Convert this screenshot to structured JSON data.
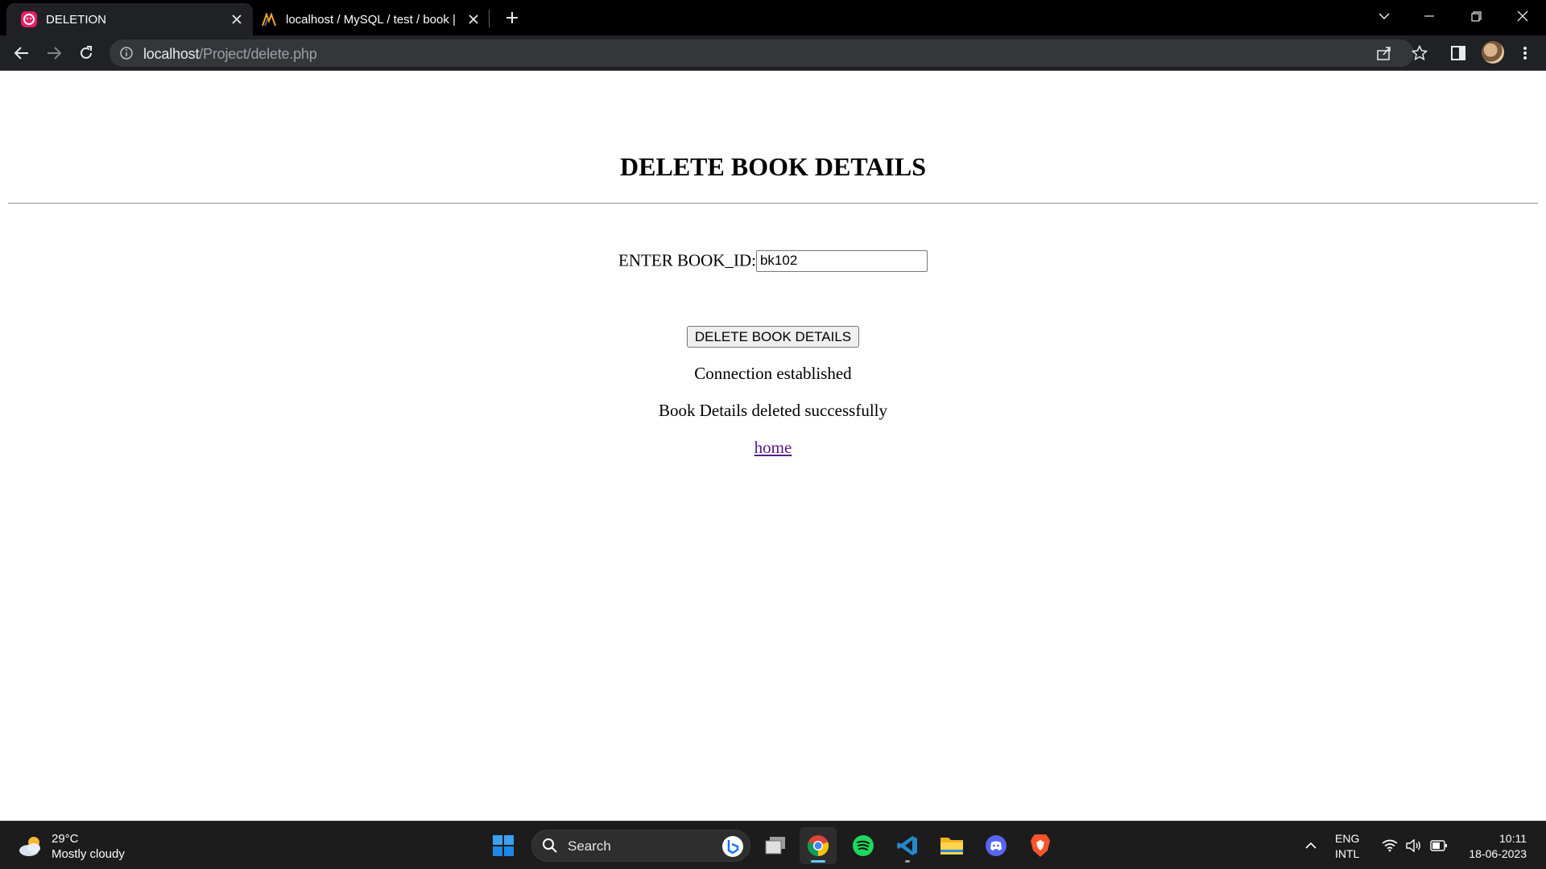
{
  "browser": {
    "tabs": [
      {
        "title": "DELETION",
        "active": true,
        "icon": "app-favicon"
      },
      {
        "title": "localhost / MySQL / test / book |",
        "active": false,
        "icon": "phpmyadmin-favicon"
      }
    ],
    "url_host": "localhost",
    "url_path": "/Project/delete.php",
    "accent": "#e91e63"
  },
  "page": {
    "heading": "DELETE BOOK DETAILS",
    "form": {
      "label": "ENTER BOOK_ID:",
      "book_id_value": "bk102",
      "submit_label": "DELETE BOOK DETAILS"
    },
    "messages": {
      "connection": "Connection established",
      "result": "Book Details deleted successfully"
    },
    "home_link": "home"
  },
  "taskbar": {
    "weather": {
      "temp": "29°C",
      "condition": "Mostly cloudy"
    },
    "search_placeholder": "Search",
    "apps": [
      "start-icon",
      "search",
      "task-view-icon",
      "chrome-icon",
      "spotify-icon",
      "vscode-icon",
      "file-explorer-icon",
      "discord-icon",
      "brave-icon"
    ],
    "lang_primary": "ENG",
    "lang_secondary": "INTL",
    "time": "10:11",
    "date": "18-06-2023"
  }
}
